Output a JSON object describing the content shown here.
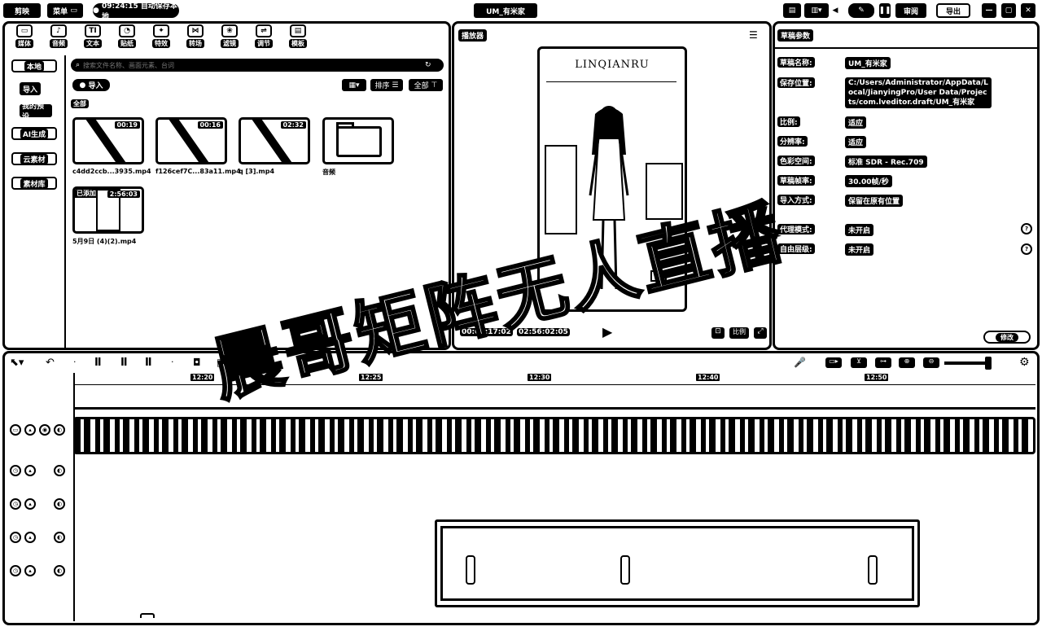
{
  "titlebar": {
    "app_name": "剪映",
    "menu_label": "菜单",
    "autosave": "09:24:15 自动保存本地",
    "project_title": "UM_有米家",
    "share_label": "审阅",
    "export_label": "导出"
  },
  "tools": [
    {
      "icon": "media-icon",
      "glyph": "▭",
      "label": "媒体"
    },
    {
      "icon": "audio-icon",
      "glyph": "♪",
      "label": "音频"
    },
    {
      "icon": "text-icon",
      "glyph": "TI",
      "label": "文本"
    },
    {
      "icon": "sticker-icon",
      "glyph": "◔",
      "label": "贴纸"
    },
    {
      "icon": "effects-icon",
      "glyph": "✦",
      "label": "特效"
    },
    {
      "icon": "transition-icon",
      "glyph": "⋈",
      "label": "转场"
    },
    {
      "icon": "filter-icon",
      "glyph": "❀",
      "label": "滤镜"
    },
    {
      "icon": "adjust-icon",
      "glyph": "⇌",
      "label": "调节"
    },
    {
      "icon": "template-icon",
      "glyph": "▤",
      "label": "模板"
    }
  ],
  "sidebar": {
    "items": [
      {
        "label": "本地"
      },
      {
        "label": "导入"
      },
      {
        "label": "我的预设"
      },
      {
        "label": "AI生成"
      },
      {
        "label": "云素材"
      },
      {
        "label": "素材库"
      }
    ]
  },
  "media": {
    "search_placeholder": "搜索文件名称、画面元素、台词",
    "import_label": "导入",
    "view_label": "",
    "sort_label": "排序",
    "filter_label": "全部",
    "section_label": "全部",
    "items": [
      {
        "name": "c4dd2ccb...3935.mp4",
        "duration": "00:19"
      },
      {
        "name": "f126cef7C...83a11.mp4",
        "duration": "00:16"
      },
      {
        "name": "q [3].mp4",
        "duration": "02:32"
      },
      {
        "name": "音频",
        "duration": ""
      },
      {
        "name": "5月9日 (4)(2).mp4",
        "duration": "2:56:03",
        "badge": "已添加"
      }
    ]
  },
  "player": {
    "title": "播放器",
    "current_time": "00:04:17:02",
    "total_time": "02:56:02:05",
    "ratio_label": "比例",
    "video_brand": "LINQIANRU"
  },
  "draft": {
    "title": "草稿参数",
    "rows": [
      {
        "label": "草稿名称:",
        "value": "UM_有米家"
      },
      {
        "label": "保存位置:",
        "value": "C:/Users/Administrator/AppData/Local/JianyingPro/User Data/Projects/com.lveditor.draft/UM_有米家"
      },
      {
        "label": "比例:",
        "value": "适应"
      },
      {
        "label": "分辨率:",
        "value": "适应"
      },
      {
        "label": "色彩空间:",
        "value": "标准 SDR - Rec.709"
      },
      {
        "label": "草稿帧率:",
        "value": "30.00帧/秒"
      },
      {
        "label": "导入方式:",
        "value": "保留在原有位置"
      },
      {
        "label": "代理模式:",
        "value": "未开启"
      },
      {
        "label": "自由层级:",
        "value": "未开启"
      }
    ],
    "modify_label": "修改"
  },
  "timeline": {
    "ticks": [
      "12:20",
      "12:25",
      "12:30",
      "12:40",
      "12:50"
    ]
  },
  "watermark": "晨哥矩阵无人直播"
}
